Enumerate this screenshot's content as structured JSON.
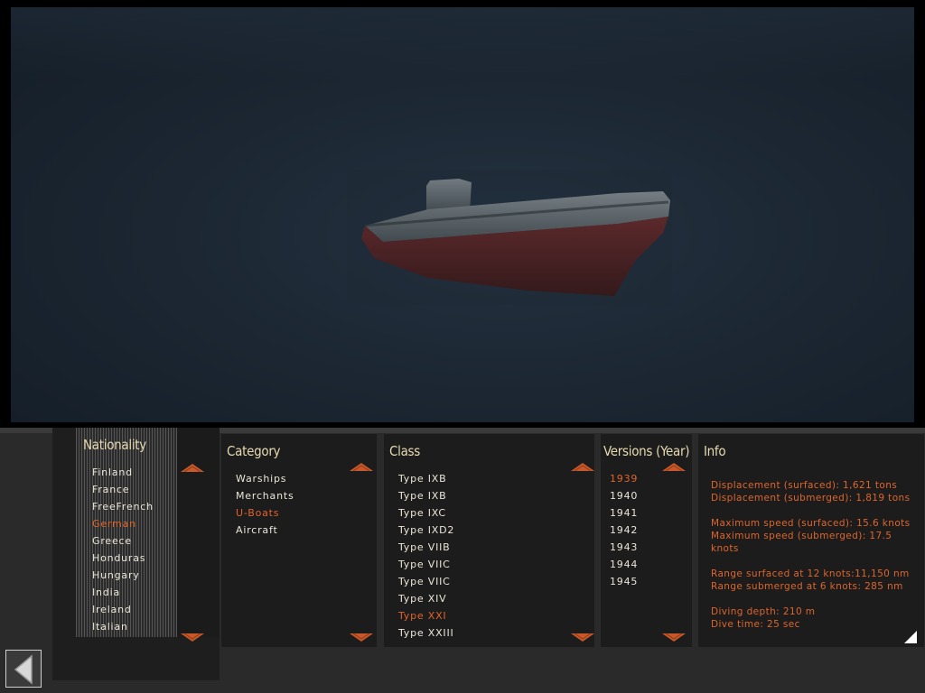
{
  "colors": {
    "accent": "#e0642a",
    "text": "#eae6d8",
    "panel": "#1c1c1c"
  },
  "nationality": {
    "title": "Nationality",
    "items": [
      "Finland",
      "France",
      "FreeFrench",
      "German",
      "Greece",
      "Honduras",
      "Hungary",
      "India",
      "Ireland",
      "Italian"
    ],
    "selected": "German"
  },
  "category": {
    "title": "Category",
    "items": [
      "Warships",
      "Merchants",
      "U-Boats",
      "Aircraft"
    ],
    "selected": "U-Boats"
  },
  "class": {
    "title": "Class",
    "items": [
      "Type IXB",
      "Type IXB",
      "Type IXC",
      "Type IXD2",
      "Type VIIB",
      "Type VIIC",
      "Type VIIC",
      "Type XIV",
      "Type XXI",
      "Type XXIII"
    ],
    "selected_index": 8
  },
  "versions": {
    "title": "Versions (Year)",
    "items": [
      "1939",
      "1940",
      "1941",
      "1942",
      "1943",
      "1944",
      "1945"
    ],
    "selected": "1939"
  },
  "info": {
    "title": "Info",
    "text": "Displacement (surfaced): 1,621 tons\nDisplacement (submerged): 1,819 tons\n\nMaximum speed (surfaced): 15.6 knots\nMaximum speed (submerged): 17.5\nknots\n\nRange surfaced at 12 knots:11,150 nm\nRange submerged at 6 knots: 285 nm\n\nDiving depth: 210 m\nDive time: 25 sec"
  },
  "icons": {
    "back": "back-arrow-icon",
    "up": "scroll-up-arrow-icon",
    "down": "scroll-down-arrow-icon",
    "resize": "corner-resize-icon"
  }
}
